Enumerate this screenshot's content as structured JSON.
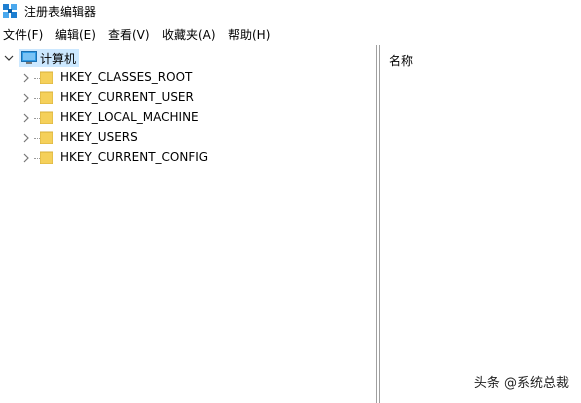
{
  "window": {
    "title": "注册表编辑器",
    "icon": "registry-editor-icon"
  },
  "menu": [
    {
      "label": "文件(F)"
    },
    {
      "label": "编辑(E)"
    },
    {
      "label": "查看(V)"
    },
    {
      "label": "收藏夹(A)"
    },
    {
      "label": "帮助(H)"
    }
  ],
  "tree": {
    "root": {
      "label": "计算机",
      "icon": "computer-icon",
      "expanded": true,
      "selected": true
    },
    "children": [
      {
        "label": "HKEY_CLASSES_ROOT",
        "icon": "folder-icon"
      },
      {
        "label": "HKEY_CURRENT_USER",
        "icon": "folder-icon"
      },
      {
        "label": "HKEY_LOCAL_MACHINE",
        "icon": "folder-icon"
      },
      {
        "label": "HKEY_USERS",
        "icon": "folder-icon"
      },
      {
        "label": "HKEY_CURRENT_CONFIG",
        "icon": "folder-icon"
      }
    ]
  },
  "list": {
    "column_name": "名称"
  },
  "watermark": "头条 @系统总裁",
  "colors": {
    "selection": "#cce8ff",
    "folder": "#f5d05a",
    "computer": "#2f9ce6"
  }
}
